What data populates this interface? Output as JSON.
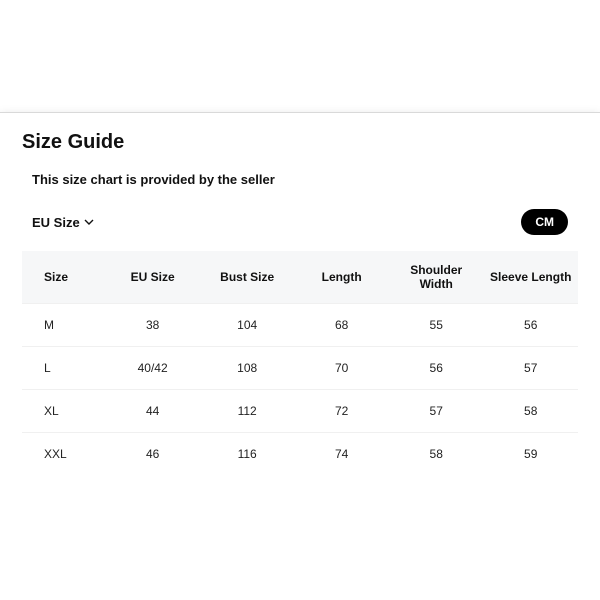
{
  "title": "Size Guide",
  "subtitle": "This size chart is provided by the seller",
  "region_label": "EU Size",
  "unit_label": "CM",
  "columns": [
    "Size",
    "EU Size",
    "Bust Size",
    "Length",
    "Shoulder Width",
    "Sleeve Length"
  ],
  "rows": [
    {
      "c0": "M",
      "c1": "38",
      "c2": "104",
      "c3": "68",
      "c4": "55",
      "c5": "56"
    },
    {
      "c0": "L",
      "c1": "40/42",
      "c2": "108",
      "c3": "70",
      "c4": "56",
      "c5": "57"
    },
    {
      "c0": "XL",
      "c1": "44",
      "c2": "112",
      "c3": "72",
      "c4": "57",
      "c5": "58"
    },
    {
      "c0": "XXL",
      "c1": "46",
      "c2": "116",
      "c3": "74",
      "c4": "58",
      "c5": "59"
    }
  ]
}
